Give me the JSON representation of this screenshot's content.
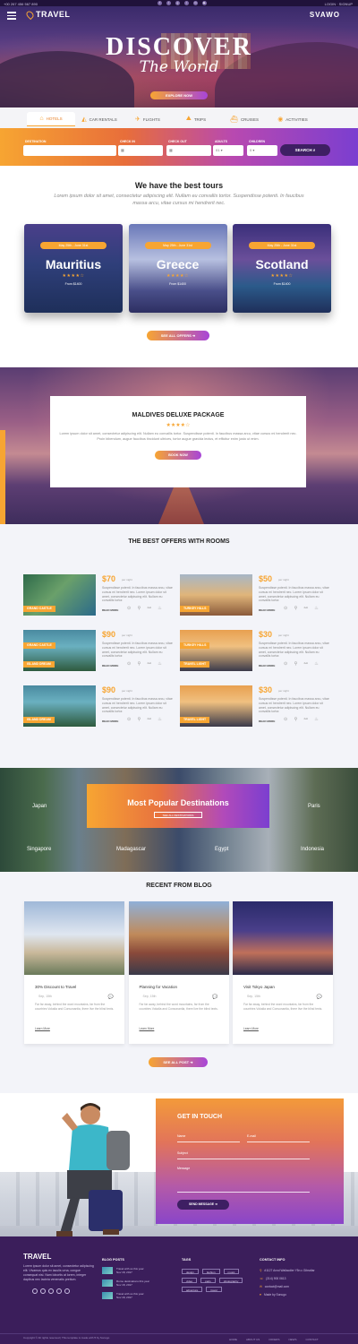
{
  "topbar": {
    "phone": "+00 267 456 567 890",
    "right": "LOGIN · SIGNUP"
  },
  "header": {
    "logo": "TRAVEL",
    "brand": "SVAWO"
  },
  "hero": {
    "title": "DISCOVER",
    "subtitle": "The World",
    "button": "EXPLORE NOW"
  },
  "search_tabs": [
    {
      "label": "HOTELS",
      "icon": "home-icon",
      "glyph": "⌂"
    },
    {
      "label": "CAR RENTALS",
      "icon": "car-icon",
      "glyph": "◭"
    },
    {
      "label": "FLIGHTS",
      "icon": "plane-icon",
      "glyph": "✈"
    },
    {
      "label": "TRIPS",
      "icon": "trip-icon",
      "glyph": "⛰"
    },
    {
      "label": "CRUISES",
      "icon": "ship-icon",
      "glyph": "⛴"
    },
    {
      "label": "ACTIVITIES",
      "icon": "activity-icon",
      "glyph": "◉"
    }
  ],
  "search_form": {
    "destination_label": "DESTINATION",
    "checkin_label": "CHECK IN",
    "checkout_label": "CHECK OUT",
    "adults_label": "ADULTS",
    "children_label": "CHILDREN",
    "adults_value": "01",
    "children_value": "0",
    "button": "SEARCH"
  },
  "best_tours": {
    "title": "We have the best tours",
    "subtitle": "Lorem ipsum dolor sit amet, consectetur adipiscing elit. Nullam eu convallis tortor. Suspendisse potenti. In faucibus massa arcu, vitae cursus mi hendrerit nec.",
    "cards": [
      {
        "name": "Mauritius",
        "date": "May 25th - June 31st",
        "stars": "★★★★☆",
        "price": "From $1400"
      },
      {
        "name": "Greece",
        "date": "May 25th - June 31st",
        "stars": "★★★★☆",
        "price": "From $1400"
      },
      {
        "name": "Scotland",
        "date": "May 25th - June 31st",
        "stars": "★★★★☆",
        "price": "From $1400"
      }
    ],
    "button": "SEE ALL OFFERS"
  },
  "maldives": {
    "title": "MALDIVES DELUXE PACKAGE",
    "stars": "★★★★☆",
    "description": "Lorem ipsum dolor sit amet, consectetur adipiscing elit. Nullam eu convallis tortor. Suspendisse potenti. In faucibus massa arcu, vitae cursus mi hendrerit nec. Proin bibendum, augue faucibus tincidunt ultrices, tortor augue gravida lectus, et efficitur enim justo ut enim.",
    "button": "BOOK NOW"
  },
  "offers": {
    "title": "THE BEST OFFERS WITH ROOMS",
    "per_night": "per night",
    "description": "Suspendisse potenti. In faucibus massa arcu, vitae cursus mi hendrerit nec. Lorem ipsum dolor sit amet, consectetur adipiscing elit. Nullam eu convallis tortor.",
    "read_more": "READ MORE",
    "amenities": "⊙ ⚲ ⚯ ♨",
    "items": [
      {
        "price": "$70",
        "tag": "GRAND CASTLE"
      },
      {
        "price": "$50",
        "tag": "TURKEY HILLS"
      },
      {
        "price": "$90",
        "tag": "ISLAND DREAM"
      },
      {
        "price": "$30",
        "tag": "TRAVEL LIGHT"
      },
      {
        "price": "$90",
        "tag": "ISLAND DREAM"
      },
      {
        "price": "$30",
        "tag": "TRAVEL LIGHT"
      }
    ],
    "extra_tag_left": "GRAND CASTLE",
    "extra_tag_right": "TURKEY HILLS"
  },
  "popular": {
    "title": "Most Popular Destinations",
    "button": "SEE ALL DESTINATIONS",
    "places": [
      "Japan",
      "Paris",
      "Singapore",
      "Madagascar",
      "Egypt",
      "Indonesia"
    ]
  },
  "blog": {
    "title": "RECENT FROM BLOG",
    "posts": [
      {
        "title": "30% Discount to Travel",
        "date": "Sep, 15th"
      },
      {
        "title": "Planning for Vacation",
        "date": "Sep, 15th"
      },
      {
        "title": "Visit Tokyo Japan",
        "date": "Sep, 15th"
      }
    ],
    "excerpt": "Far far away, behind the word mountains, far from the countries Vokalia and Consonantia, there live the blind texts.",
    "read_more": "Learn More",
    "button": "SEE ALL POST"
  },
  "contact": {
    "title": "GET IN TOUCH",
    "name_label": "Name",
    "email_label": "E-mail",
    "subject_label": "Subject",
    "message_label": "Message",
    "button": "SEND MESSAGE"
  },
  "footer": {
    "logo": "TRAVEL",
    "about": "Lorem ipsum dolor sit amet, consectetur adipiscing elit. Vivamus quis ex iaculis urna, congue consequat nisi. Nam lobortis at lorem, integer dapibus nec lacinia venenatis pretium.",
    "blog_heading": "BLOG POSTS",
    "tags_heading": "TAGS",
    "contact_heading": "CONTACT INFO",
    "blog_posts": [
      {
        "text": "Travel with us this year",
        "date": "Nov 18, 2017"
      },
      {
        "text": "Rome destinations this year",
        "date": "Nov 18, 2017"
      },
      {
        "text": "Travel with us this year",
        "date": "Nov 18, 2017"
      }
    ],
    "tags": [
      "design",
      "fashion",
      "music",
      "video",
      "paris",
      "photography",
      "adventure",
      "travel"
    ],
    "contact": [
      "#1127 Avnd Wallacdler Y5n c Gibraltar",
      "(314) 900 0613",
      "contact@mail.com",
      "Made by Sonugo"
    ],
    "copyright": "Copyright © All rights reserved | This template is made with ♥ by Sonugo",
    "nav": [
      "HOME",
      "ABOUT US",
      "OFFERS",
      "NEWS",
      "CONTACT"
    ]
  }
}
